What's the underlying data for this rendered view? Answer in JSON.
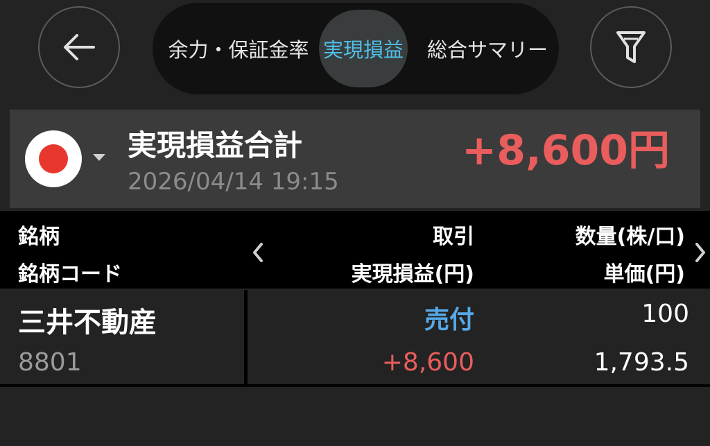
{
  "header": {
    "tabs": [
      {
        "label": "余力・保証金率",
        "active": false
      },
      {
        "label": "実現損益",
        "active": true
      },
      {
        "label": "総合サマリー",
        "active": false
      }
    ],
    "icons": {
      "back": "arrow-left-icon",
      "filter": "filter-icon"
    }
  },
  "summary": {
    "title": "実現損益合計",
    "timestamp": "2026/04/14 19:15",
    "total": "+8,600円",
    "market_flag": "japan-flag-icon"
  },
  "table": {
    "headers": {
      "col1_line1": "銘柄",
      "col1_line2": "銘柄コード",
      "col2_line1": "取引",
      "col2_line2": "実現損益(円)",
      "col3_line1": "数量(株/口)",
      "col3_line2": "単価(円)"
    },
    "rows": [
      {
        "name": "三井不動産",
        "code": "8801",
        "trade": "売付",
        "realized_pl": "+8,600",
        "quantity": "100",
        "unit_price": "1,793.5"
      }
    ]
  },
  "colors": {
    "accent": "#4ec0e8",
    "profit": "#ea5d5d",
    "sell": "#56a9e8",
    "background": "#232323"
  }
}
